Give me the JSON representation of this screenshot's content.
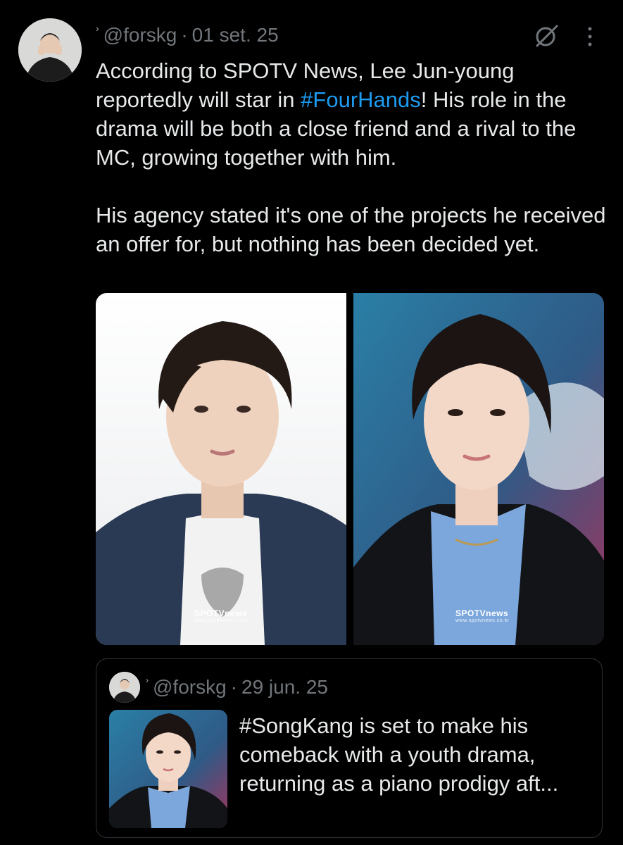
{
  "tweet": {
    "author_handle": "@forskg",
    "date": "01 set. 25",
    "text_prefix": "According to SPOTV News, Lee Jun-young reportedly will star in ",
    "hashtag": "#FourHands",
    "text_suffix": "! His role in the drama will be both a close friend and a rival to the MC, growing together with him.\n\nHis agency stated it's one of the projects he received an offer for, but nothing has been decided yet.",
    "separator": "·",
    "mini_emoji": "›",
    "grok_icon": "grok-icon",
    "more_icon": "more-vertical-icon",
    "photos": [
      {
        "watermark": "SPOTVnews",
        "watermark_sub": "www.spotvnews.co.kr"
      },
      {
        "watermark": "SPOTVnews",
        "watermark_sub": "www.spotvnews.co.kr"
      }
    ]
  },
  "quote": {
    "author_handle": "@forskg",
    "separator": "·",
    "date": "29 jun. 25",
    "text": "#SongKang is set to make his comeback with a youth drama, returning as a piano prodigy aft..."
  },
  "colors": {
    "background": "#000000",
    "text": "#e7e9ea",
    "secondary": "#71767b",
    "link": "#1d9bf0",
    "border": "#2f3336"
  }
}
